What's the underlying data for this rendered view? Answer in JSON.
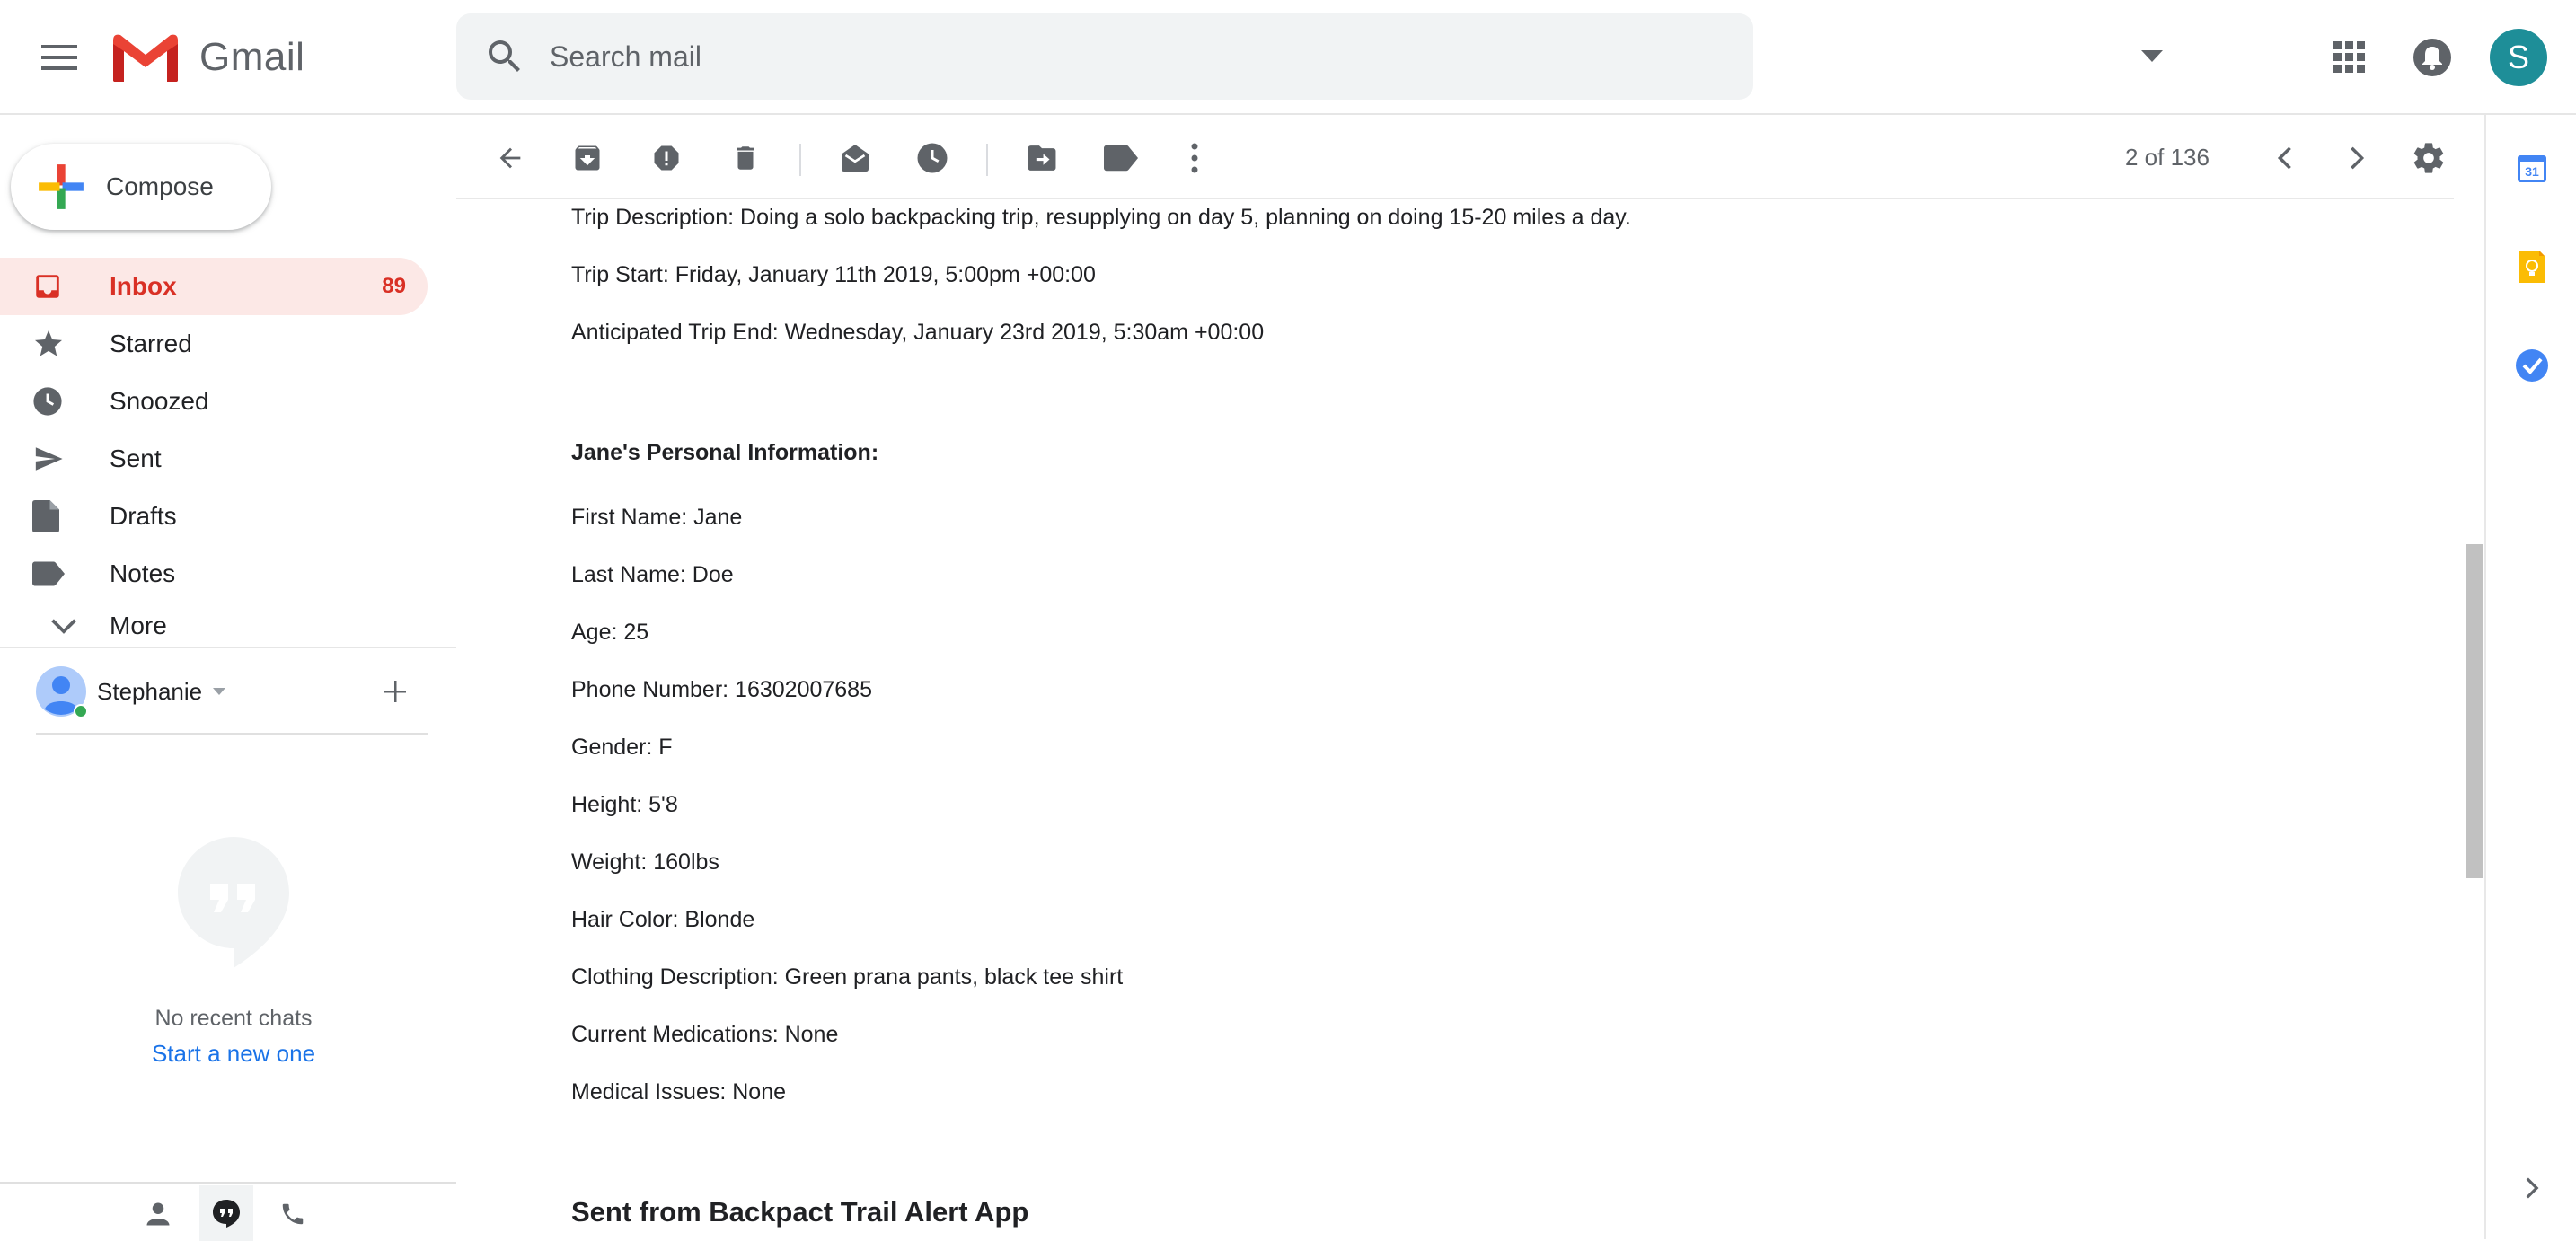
{
  "app": {
    "name": "Gmail"
  },
  "search": {
    "placeholder": "Search mail"
  },
  "account": {
    "avatar_letter": "S"
  },
  "compose": {
    "label": "Compose"
  },
  "sidebar": {
    "items": [
      {
        "label": "Inbox",
        "count": "89",
        "icon": "inbox-icon"
      },
      {
        "label": "Starred",
        "icon": "star-icon"
      },
      {
        "label": "Snoozed",
        "icon": "clock-icon"
      },
      {
        "label": "Sent",
        "icon": "send-icon"
      },
      {
        "label": "Drafts",
        "icon": "draft-icon"
      },
      {
        "label": "Notes",
        "icon": "label-icon"
      },
      {
        "label": "More",
        "icon": "chevron-down-icon"
      }
    ]
  },
  "hangouts": {
    "user": "Stephanie",
    "no_chats": "No recent chats",
    "start_new": "Start a new one"
  },
  "toolbar": {
    "page_count": "2 of 136"
  },
  "email": {
    "lines": [
      "Trip Description: Doing a solo backpacking trip, resupplying on day 5, planning on doing 15-20 miles a day.",
      "Trip Start: Friday, January 11th 2019, 5:00pm +00:00",
      "Anticipated Trip End: Wednesday, January 23rd 2019, 5:30am +00:00",
      "Jane's Personal Information:",
      "First Name: Jane",
      "Last Name: Doe",
      "Age: 25",
      "Phone Number: 16302007685",
      "Gender: F",
      "Height: 5'8",
      "Weight: 160lbs",
      "Hair Color: Blonde",
      "Clothing Description: Green prana pants, black tee shirt",
      "Current Medications: None",
      "Medical Issues: None",
      "Sent from Backpact Trail Alert App"
    ]
  },
  "colors": {
    "accent_red": "#d93025",
    "active_bg": "#fce8e6",
    "link_blue": "#1a73e8",
    "avatar_bg": "#1e8e98"
  }
}
